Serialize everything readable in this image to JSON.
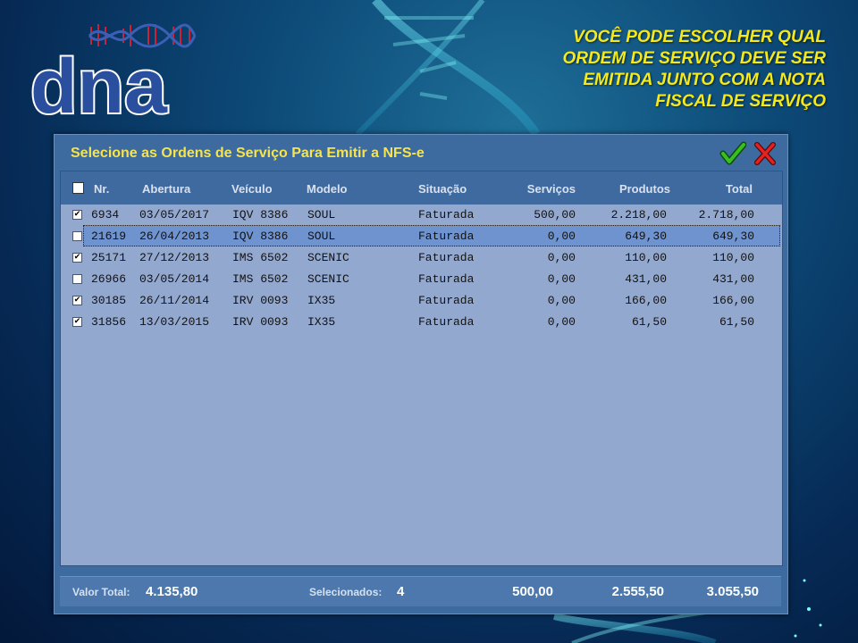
{
  "caption": {
    "lines": [
      "VOCÊ PODE ESCOLHER QUAL",
      "ORDEM  DE SERVIÇO DEVE SER",
      "EMITIDA JUNTO COM A NOTA",
      "FISCAL DE SERVIÇO"
    ]
  },
  "logo": {
    "text": "dna"
  },
  "dialog": {
    "title": "Selecione as Ordens de Serviço Para Emitir a NFS-e",
    "ok_icon": "checkmark-icon",
    "cancel_icon": "close-icon"
  },
  "table": {
    "headers": [
      "Nr.",
      "Abertura",
      "Veículo",
      "Modelo",
      "Situação",
      "Serviços",
      "Produtos",
      "Total"
    ],
    "rows": [
      {
        "checked": true,
        "nr": "6934",
        "abertura": "03/05/2017",
        "veiculo": "IQV 8386",
        "modelo": "SOUL",
        "situacao": "Faturada",
        "servicos": "500,00",
        "produtos": "2.218,00",
        "total": "2.718,00"
      },
      {
        "checked": false,
        "nr": "21619",
        "abertura": "26/04/2013",
        "veiculo": "IQV 8386",
        "modelo": "SOUL",
        "situacao": "Faturada",
        "servicos": "0,00",
        "produtos": "649,30",
        "total": "649,30"
      },
      {
        "checked": true,
        "nr": "25171",
        "abertura": "27/12/2013",
        "veiculo": "IMS 6502",
        "modelo": "SCENIC",
        "situacao": "Faturada",
        "servicos": "0,00",
        "produtos": "110,00",
        "total": "110,00"
      },
      {
        "checked": false,
        "nr": "26966",
        "abertura": "03/05/2014",
        "veiculo": "IMS 6502",
        "modelo": "SCENIC",
        "situacao": "Faturada",
        "servicos": "0,00",
        "produtos": "431,00",
        "total": "431,00"
      },
      {
        "checked": true,
        "nr": "30185",
        "abertura": "26/11/2014",
        "veiculo": "IRV 0093",
        "modelo": "IX35",
        "situacao": "Faturada",
        "servicos": "0,00",
        "produtos": "166,00",
        "total": "166,00"
      },
      {
        "checked": true,
        "nr": "31856",
        "abertura": "13/03/2015",
        "veiculo": "IRV 0093",
        "modelo": "IX35",
        "situacao": "Faturada",
        "servicos": "0,00",
        "produtos": "61,50",
        "total": "61,50"
      }
    ]
  },
  "footer": {
    "valor_total_label": "Valor Total:",
    "valor_total": "4.135,80",
    "selecionados_label": "Selecionados:",
    "selecionados": "4",
    "servicos_total": "500,00",
    "produtos_total": "2.555,50",
    "total": "3.055,50"
  },
  "colors": {
    "caption": "#f4e91a",
    "dialog_title": "#f7e44a",
    "dialog_bg": "#3d6ba0",
    "grid_bg": "#93a8cf",
    "ok": "#2e9e1f",
    "cancel": "#d11a1a"
  }
}
